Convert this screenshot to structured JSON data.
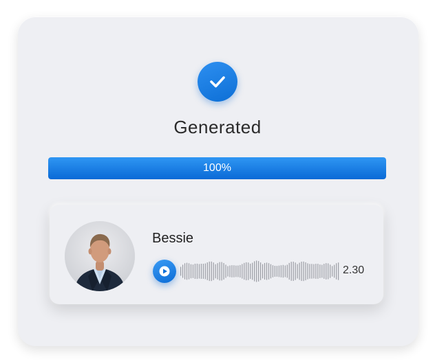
{
  "status": {
    "title": "Generated",
    "icon": "check-icon",
    "accent_color": "#1a7de3"
  },
  "progress": {
    "label": "100%",
    "value": 1.0
  },
  "voice": {
    "name": "Bessie",
    "duration": "2.30",
    "play_icon": "play-icon",
    "avatar_icon": "avatar-photo"
  }
}
